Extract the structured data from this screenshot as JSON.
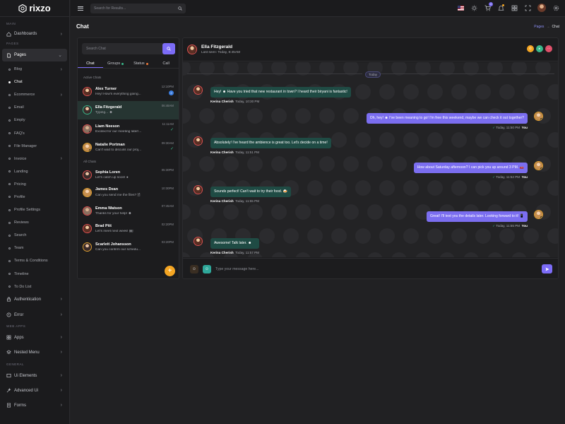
{
  "app": {
    "brand": "rixzo"
  },
  "topbar": {
    "search_placeholder": "Search for Results...",
    "cart_count": "4"
  },
  "sidebar": {
    "sections": {
      "main": "MAIN",
      "pages": "PAGES",
      "web_apps": "WEB APPS",
      "general": "GENERAL"
    },
    "dashboards": "Dashboards",
    "pages": "Pages",
    "subitems": [
      "Blog",
      "Chat",
      "Ecommerce",
      "Email",
      "Empty",
      "FAQ's",
      "File Manager",
      "Invoice",
      "Landing",
      "Pricing",
      "Profile",
      "Profile Settings",
      "Reviews",
      "Search",
      "Team",
      "Terms & Conditions",
      "Timeline",
      "To Do List"
    ],
    "authentication": "Authentication",
    "error": "Error",
    "apps": "Apps",
    "nested_menu": "Nested Menu",
    "ui_elements": "Ui Elements",
    "advanced_ui": "Advanced Ui",
    "forms": "Forms"
  },
  "page": {
    "title": "Chat",
    "breadcrumb": [
      "Pages",
      "→",
      "Chat"
    ]
  },
  "chat_list": {
    "search_placeholder": "Search Chat",
    "tabs": [
      {
        "label": "Chat"
      },
      {
        "label": "Groups"
      },
      {
        "label": "Status"
      },
      {
        "label": "Call"
      }
    ],
    "active_heading": "Active Chats",
    "all_heading": "All Chats",
    "active": [
      {
        "name": "Alex Turner",
        "preview": "Hey! How's everything going...",
        "time": "12:10PM",
        "unread": "2"
      },
      {
        "name": "Ella Fitzgerald",
        "preview": "Typing... ☻",
        "time": "06:48AM",
        "unread": ""
      },
      {
        "name": "Liam Neeson",
        "preview": "Excited for our meeting later!...",
        "time": "11:11AM",
        "unread": ""
      },
      {
        "name": "Natalie Portman",
        "preview": "Can't wait to discuss our proj...",
        "time": "09:30AM",
        "unread": ""
      }
    ],
    "all": [
      {
        "name": "Sophia Loren",
        "preview": "Let's catch up soon! ●",
        "time": "05:30PM"
      },
      {
        "name": "James Dean",
        "preview": "Can you send me the files? 🗎",
        "time": "10:30PM"
      },
      {
        "name": "Emma Watson",
        "preview": "Thanks for your help! ☻",
        "time": "07:45AM"
      },
      {
        "name": "Brad Pitt",
        "preview": "Let's meet next week! 🗓",
        "time": "02:20PM"
      },
      {
        "name": "Scarlett Johansson",
        "preview": "Can you confirm our schedu...",
        "time": "03:20PM"
      }
    ]
  },
  "conversation": {
    "name": "Ella Fitzgerald",
    "status": "Last seen: Today, 8:45AM",
    "day_label": "Today",
    "messages": [
      {
        "dir": "in",
        "text": "Hey! ☻ Have you tried that new restaurant in town? I heard their biryani is fantastic!",
        "sender": "Kerina Cherish",
        "time": "Today, 10:30 PM"
      },
      {
        "dir": "out",
        "text": "Oh, hey! ☻ I've been meaning to go! I'm free this weekend, maybe we can check it out together?",
        "sender": "You",
        "time": "Today, 11:50 PM"
      },
      {
        "dir": "in",
        "text": "Absolutely! I've heard the ambience is great too. Let's decide on a time!",
        "sender": "Kerina Cherish",
        "time": "Today, 11:51 PM"
      },
      {
        "dir": "out",
        "text": "How about Saturday afternoon? I can pick you up around 3 PM. 🚗",
        "sender": "You",
        "time": "Today, 11:52 PM"
      },
      {
        "dir": "in",
        "text": "Sounds perfect! Can't wait to try their food. 🍛",
        "sender": "Kerina Cherish",
        "time": "Today, 11:55 PM"
      },
      {
        "dir": "out",
        "text": "Great! I'll text you the details later. Looking forward to it! 📱",
        "sender": "You",
        "time": "Today, 11:55 PM"
      },
      {
        "dir": "in",
        "text": "Awesome! Talk later. ☻",
        "sender": "Kerina Cherish",
        "time": "Today, 11:57 PM"
      }
    ],
    "composer_placeholder": "Type your message here..."
  },
  "colors": {
    "accent": "#7c6cf7",
    "incoming": "#1f4b44",
    "outgoing": "#7b6ef0",
    "online": "#3ab88a"
  }
}
